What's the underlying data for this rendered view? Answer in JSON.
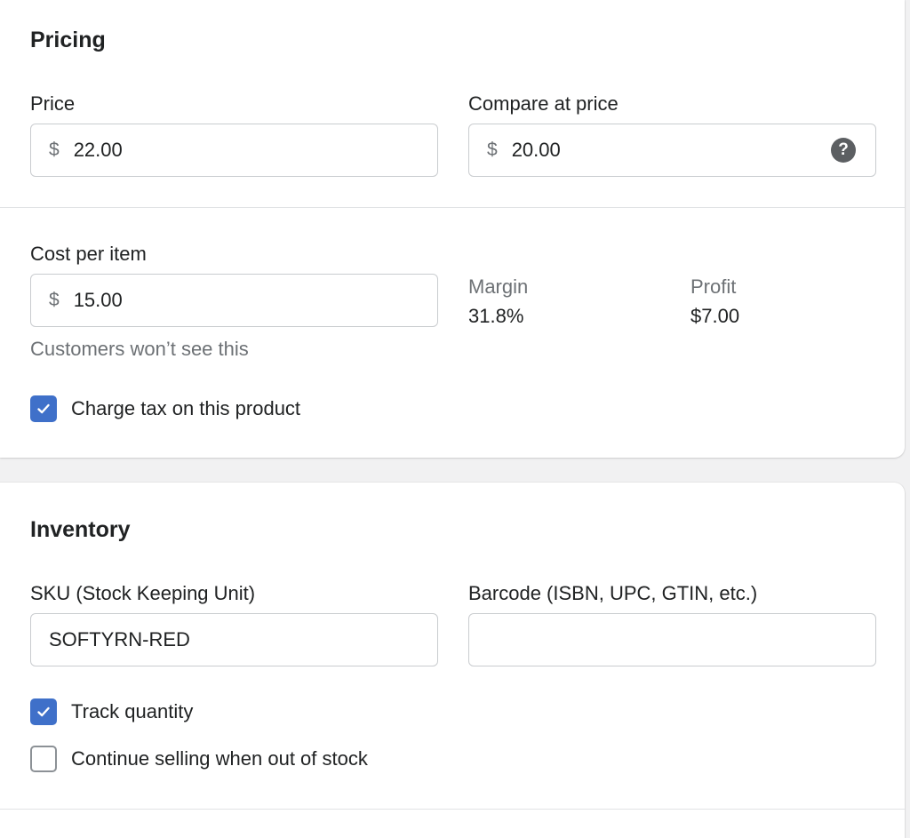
{
  "pricing": {
    "title": "Pricing",
    "price": {
      "label": "Price",
      "prefix": "$",
      "value": "22.00"
    },
    "compare_at_price": {
      "label": "Compare at price",
      "prefix": "$",
      "value": "20.00",
      "help_icon": "question-circle-icon",
      "help_symbol": "?"
    },
    "cost_per_item": {
      "label": "Cost per item",
      "prefix": "$",
      "value": "15.00",
      "hint": "Customers won’t see this"
    },
    "margin": {
      "label": "Margin",
      "value": "31.8%"
    },
    "profit": {
      "label": "Profit",
      "value": "$7.00"
    },
    "charge_tax": {
      "label": "Charge tax on this product",
      "checked": true
    }
  },
  "inventory": {
    "title": "Inventory",
    "sku": {
      "label": "SKU (Stock Keeping Unit)",
      "value": "SOFTYRN-RED"
    },
    "barcode": {
      "label": "Barcode (ISBN, UPC, GTIN, etc.)",
      "value": ""
    },
    "track_quantity": {
      "label": "Track quantity",
      "checked": true
    },
    "continue_selling": {
      "label": "Continue selling when out of stock",
      "checked": false
    }
  },
  "colors": {
    "checkbox_accent": "#3f70c9",
    "text_primary": "#202223",
    "text_subdued": "#6d7175",
    "border": "#c9cccf"
  }
}
